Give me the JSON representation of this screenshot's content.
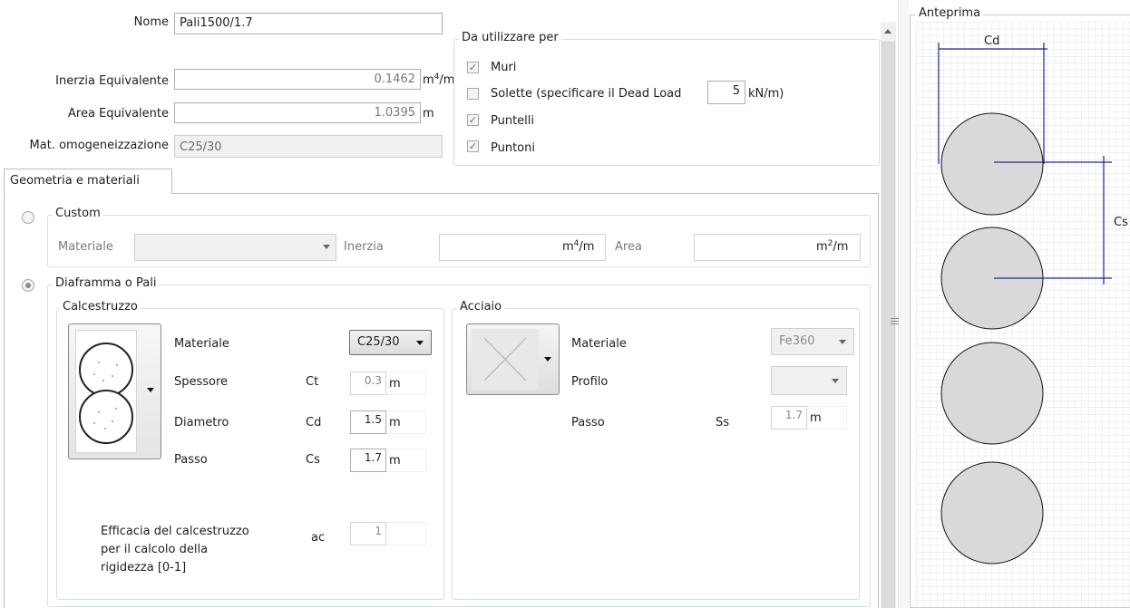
{
  "header": {
    "nome_label": "Nome",
    "nome_value": "Pali1500/1.7",
    "inerzia_label": "Inerzia Equivalente",
    "inerzia_value": "0.1462",
    "inerzia_unit_base": "m",
    "inerzia_unit_exp": "4",
    "inerzia_unit_tail": "/m",
    "area_label": "Area Equivalente",
    "area_value": "1.0395",
    "area_unit": "m",
    "mat_label": "Mat. omogeneizzazione",
    "mat_value": "C25/30"
  },
  "usage": {
    "title": "Da utilizzare per",
    "muri": {
      "label": "Muri",
      "checked": true
    },
    "solette": {
      "label": "Solette  (specificare il Dead Load",
      "checked": false,
      "value": "5",
      "unit": "kN/m)"
    },
    "puntelli": {
      "label": "Puntelli",
      "checked": true
    },
    "puntoni": {
      "label": "Puntoni",
      "checked": true
    }
  },
  "tabs": [
    {
      "label": "Geometria e materiali",
      "active": true
    }
  ],
  "custom": {
    "title": "Custom",
    "materiale_label": "Materiale",
    "materiale_value": "",
    "inerzia_label": "Inerzia",
    "inerzia_value": "",
    "inerzia_unit_base": "m",
    "inerzia_unit_exp": "4",
    "inerzia_unit_tail": "/m",
    "area_label": "Area",
    "area_value": "",
    "area_unit_base": "m",
    "area_unit_exp": "2",
    "area_unit_tail": "/m"
  },
  "diaframma": {
    "title": "Diaframma o Pali",
    "calcestruzzo": {
      "title": "Calcestruzzo",
      "materiale_label": "Materiale",
      "materiale_value": "C25/30",
      "spessore_label": "Spessore",
      "spessore_sym": "Ct",
      "spessore_value": "0.3",
      "spessore_unit": "m",
      "diametro_label": "Diametro",
      "diametro_sym": "Cd",
      "diametro_value": "1.5",
      "diametro_unit": "m",
      "passo_label": "Passo",
      "passo_sym": "Cs",
      "passo_value": "1.7",
      "passo_unit": "m",
      "efficacia_line1": "Efficacia del calcestruzzo",
      "efficacia_line2": "per il calcolo della",
      "efficacia_line3": "rigidezza  [0-1]",
      "efficacia_sym": "ac",
      "efficacia_value": "1"
    },
    "acciaio": {
      "title": "Acciaio",
      "materiale_label": "Materiale",
      "materiale_value": "Fe360",
      "profilo_label": "Profilo",
      "profilo_value": "",
      "passo_label": "Passo",
      "passo_sym": "Ss",
      "passo_value": "1.7",
      "passo_unit": "m"
    }
  },
  "preview": {
    "title": "Anteprima",
    "cd_label": "Cd",
    "cs_label": "Cs"
  },
  "colors": {
    "accent_line": "#1f2a8c",
    "circle_fill": "#d9d9d9",
    "grid": "#c9d0dc"
  }
}
